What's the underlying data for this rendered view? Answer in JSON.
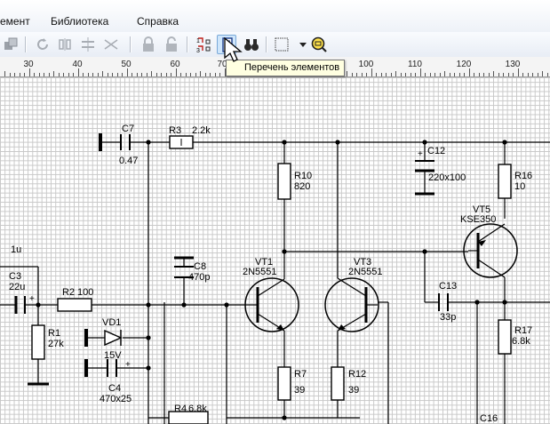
{
  "menu": [
    "емент",
    "Библиотека",
    "Справка"
  ],
  "tooltip": "Перечень элементов",
  "ruler": [
    "30",
    "40",
    "50",
    "60",
    "70",
    "80",
    "90",
    "100",
    "110",
    "120",
    "130"
  ],
  "components": {
    "C7": {
      "ref": "C7",
      "value": "0.47"
    },
    "R3": {
      "ref": "R3",
      "value": "2.2k"
    },
    "R10": {
      "ref": "R10",
      "value": "820"
    },
    "C12": {
      "ref": "C12",
      "value": "220x100"
    },
    "R16": {
      "ref": "R16",
      "value": "10"
    },
    "VT5": {
      "ref": "VT5",
      "value": "KSE350"
    },
    "C3": {
      "ref": "C3",
      "value": "22u"
    },
    "in_val": "1u",
    "R2": {
      "ref": "R2",
      "value": "100"
    },
    "C8": {
      "ref": "C8",
      "value": "470p"
    },
    "VT1": {
      "ref": "VT1",
      "value": "2N5551"
    },
    "VT3": {
      "ref": "VT3",
      "value": "2N5551"
    },
    "C13": {
      "ref": "C13",
      "value": "33p"
    },
    "R1": {
      "ref": "R1",
      "value": "27k"
    },
    "VD1": {
      "ref": "VD1",
      "value": "15V"
    },
    "R17": {
      "ref": "R17",
      "value": "6.8k"
    },
    "C4": {
      "ref": "C4",
      "value": "470x25"
    },
    "R7": {
      "ref": "R7",
      "value": "39"
    },
    "R12": {
      "ref": "R12",
      "value": "39"
    },
    "R4": {
      "ref": "R4",
      "value": "6.8k"
    },
    "C16": {
      "ref": "C16"
    }
  }
}
